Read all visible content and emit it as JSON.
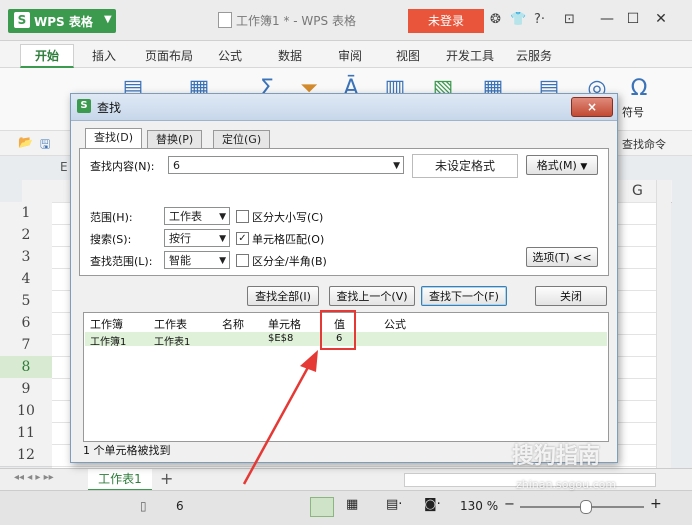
{
  "app": {
    "name": "WPS 表格",
    "doc_title": "工作簿1 * - WPS 表格",
    "login": "未登录"
  },
  "ribbon_tabs": [
    "开始",
    "插入",
    "页面布局",
    "公式",
    "数据",
    "审阅",
    "视图",
    "开发工具",
    "云服务"
  ],
  "ribbon": {
    "symbol_label": "符号",
    "find_command": "查找命令"
  },
  "grid": {
    "column_headers": [
      "E",
      "G"
    ],
    "rows": [
      "1",
      "2",
      "3",
      "4",
      "5",
      "6",
      "7",
      "8",
      "9",
      "10",
      "11",
      "12"
    ],
    "selected_row": "8"
  },
  "sheet_tab": "工作表1",
  "status": {
    "cell_value": "6",
    "zoom": "130 %"
  },
  "dialog": {
    "title": "查找",
    "close": "×",
    "tabs": [
      "查找(D)",
      "替换(P)",
      "定位(G)"
    ],
    "find_label": "查找内容(N):",
    "find_value": "6",
    "format_status": "未设定格式",
    "format_button": "格式(M)",
    "scope_label": "范围(H):",
    "scope_value": "工作表",
    "search_label": "搜索(S):",
    "search_value": "按行",
    "lookin_label": "查找范围(L):",
    "lookin_value": "智能",
    "match_case": {
      "label": "区分大小写(C)",
      "checked": false
    },
    "match_cell": {
      "label": "单元格匹配(O)",
      "checked": true
    },
    "match_width": {
      "label": "区分全/半角(B)",
      "checked": false
    },
    "options_button": "选项(T) <<",
    "buttons": [
      "查找全部(I)",
      "查找上一个(V)",
      "查找下一个(F)",
      "关闭"
    ],
    "result_headers": [
      "工作簿",
      "工作表",
      "名称",
      "单元格",
      "值",
      "公式"
    ],
    "result_row": [
      "工作簿1",
      "工作表1",
      "",
      "$E$8",
      "6",
      ""
    ],
    "result_status": "1 个单元格被找到"
  },
  "watermark": {
    "text": "搜狗指南",
    "url": "zhinan.sogou.com"
  },
  "colors": {
    "accent": "#3c9a4f",
    "login": "#e8553a",
    "highlight": "#e53935"
  }
}
